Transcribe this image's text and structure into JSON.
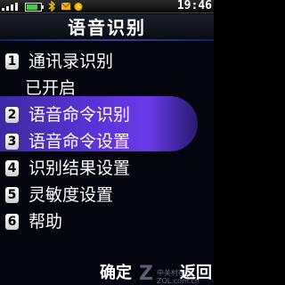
{
  "status_bar": {
    "time": "19:46",
    "battery_color": "#3bd23b"
  },
  "header": {
    "title": "语音识别"
  },
  "menu": {
    "selected_index": 0,
    "highlight_color": "#5a32d6",
    "items": [
      {
        "number": "1",
        "label": "通讯录识别",
        "sub": "已开启"
      },
      {
        "number": "2",
        "label": "语音命令识别"
      },
      {
        "number": "3",
        "label": "语音命令设置"
      },
      {
        "number": "4",
        "label": "识别结果设置"
      },
      {
        "number": "5",
        "label": "灵敏度设置"
      },
      {
        "number": "6",
        "label": "帮助"
      }
    ]
  },
  "softkeys": {
    "left": "确定",
    "right": "返回"
  },
  "watermark": {
    "line1": "中关村在线",
    "line2": "ZOL.com.cn"
  },
  "icons": [
    "signal-icon",
    "battery-icon",
    "bluetooth-icon",
    "message-icon",
    "alarm-icon"
  ]
}
